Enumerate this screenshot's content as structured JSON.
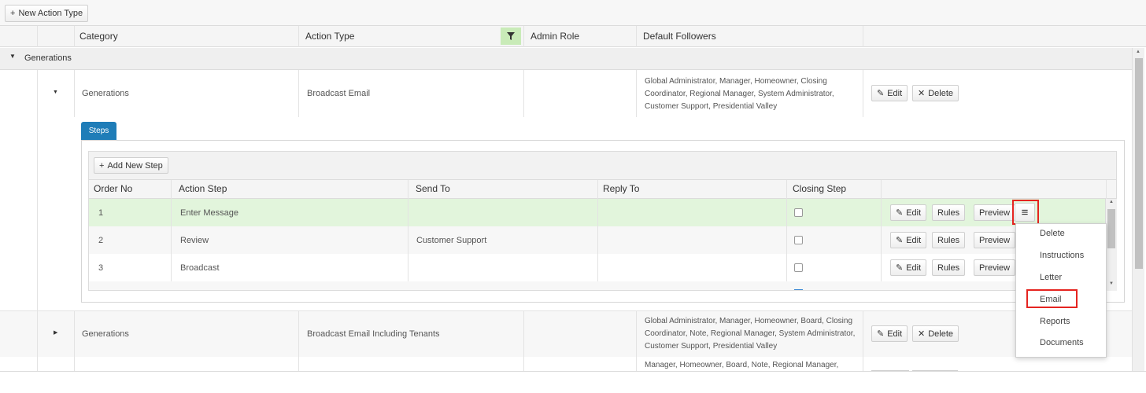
{
  "toolbar": {
    "new_action_type": "New Action Type"
  },
  "main_grid": {
    "headers": {
      "category": "Category",
      "action_type": "Action Type",
      "admin_role": "Admin Role",
      "default_followers": "Default Followers"
    },
    "group": {
      "label": "Generations"
    },
    "rows": [
      {
        "category": "Generations",
        "action_type": "Broadcast Email",
        "admin_role": "",
        "followers": "Global Administrator, Manager, Homeowner, Closing Coordinator, Regional Manager, System Administrator, Customer Support, Presidential Valley",
        "edit": "Edit",
        "delete": "Delete"
      },
      {
        "category": "Generations",
        "action_type": "Broadcast Email Including Tenants",
        "admin_role": "",
        "followers": "Global Administrator, Manager, Homeowner, Board, Closing Coordinator, Note, Regional Manager, System Administrator, Customer Support, Presidential Valley",
        "edit": "Edit",
        "delete": "Delete"
      },
      {
        "followers": "Manager, Homeowner, Board, Note, Regional Manager,"
      }
    ]
  },
  "steps_panel": {
    "tab_label": "Steps",
    "add_new_step": "Add New Step",
    "headers": {
      "order_no": "Order No",
      "action_step": "Action Step",
      "send_to": "Send To",
      "reply_to": "Reply To",
      "closing_step": "Closing Step"
    },
    "rows": [
      {
        "order": "1",
        "step": "Enter Message",
        "send_to": "",
        "reply_to": "",
        "closing": false,
        "selected": true
      },
      {
        "order": "2",
        "step": "Review",
        "send_to": "Customer Support",
        "reply_to": "",
        "closing": false,
        "selected": false
      },
      {
        "order": "3",
        "step": "Broadcast",
        "send_to": "",
        "reply_to": "",
        "closing": false,
        "selected": false
      }
    ],
    "row_buttons": {
      "edit": "Edit",
      "rules": "Rules",
      "preview": "Preview"
    }
  },
  "dropdown_menu": {
    "items": [
      "Delete",
      "Instructions",
      "Letter",
      "Email",
      "Reports",
      "Documents"
    ]
  },
  "colors": {
    "selected_row": "#e2f5dc",
    "header_bg": "#f5f5f5",
    "tab_active": "#1f7db8",
    "highlight_border": "#e52420",
    "filter_bg": "#c9ebb8"
  }
}
